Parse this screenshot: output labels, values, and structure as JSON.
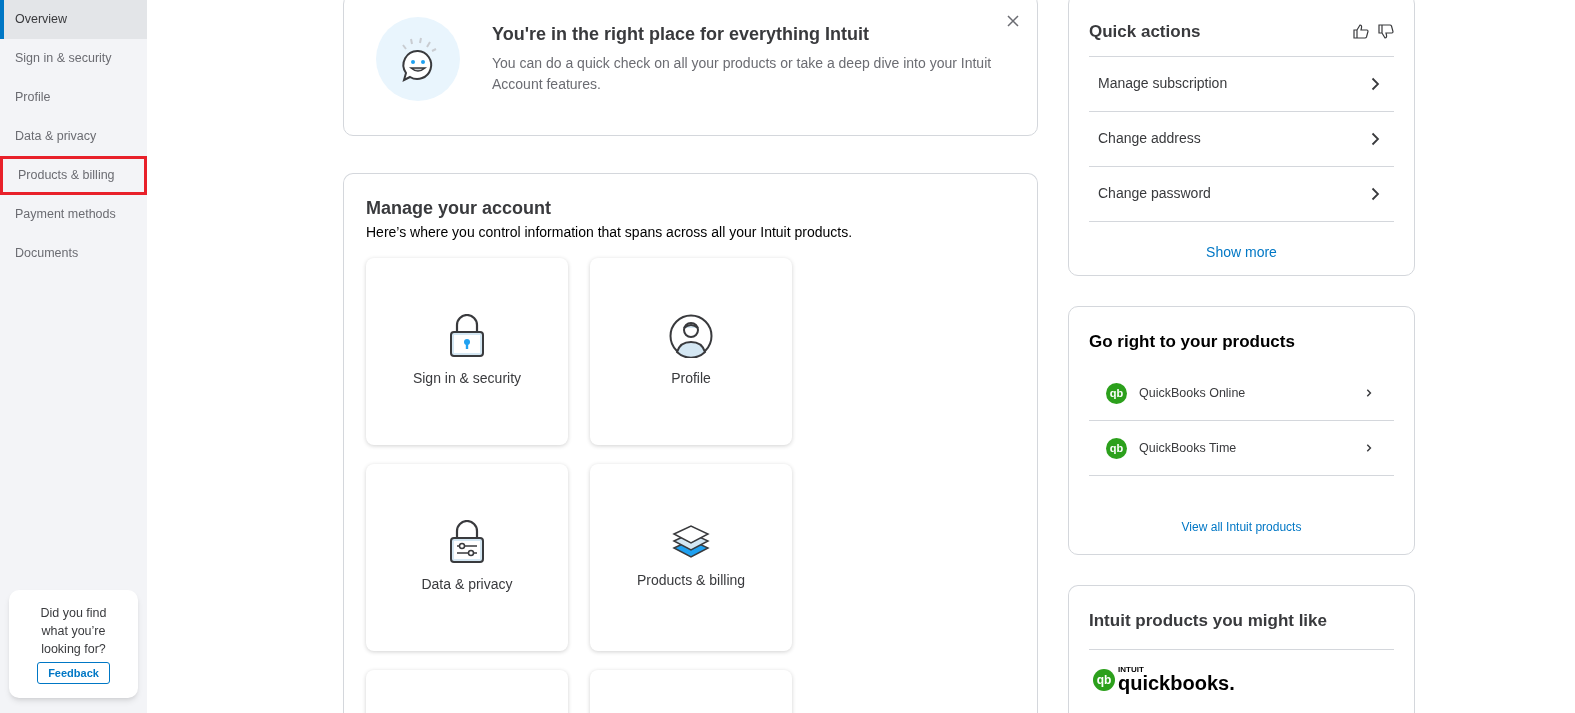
{
  "sidebar": {
    "items": [
      {
        "label": "Overview",
        "selected": true,
        "highlighted": false
      },
      {
        "label": "Sign in & security",
        "selected": false,
        "highlighted": false
      },
      {
        "label": "Profile",
        "selected": false,
        "highlighted": false
      },
      {
        "label": "Data & privacy",
        "selected": false,
        "highlighted": false
      },
      {
        "label": "Products & billing",
        "selected": false,
        "highlighted": true
      },
      {
        "label": "Payment methods",
        "selected": false,
        "highlighted": false
      },
      {
        "label": "Documents",
        "selected": false,
        "highlighted": false
      }
    ],
    "feedback": {
      "question": "Did you find what you’re looking for?",
      "button": "Feedback"
    }
  },
  "banner": {
    "title": "You're in the right place for everything Intuit",
    "text": "You can do a quick check on all your products or take a deep dive into your Intuit Account features."
  },
  "manage": {
    "title": "Manage your account",
    "subtitle": "Here’s where you control information that spans across all your Intuit products.",
    "tiles": [
      {
        "kind": "lock",
        "label": "Sign in & security"
      },
      {
        "kind": "person",
        "label": "Profile"
      },
      {
        "kind": "sliders",
        "label": "Data & privacy"
      },
      {
        "kind": "layers",
        "label": "Products & billing"
      },
      {
        "kind": "blank"
      },
      {
        "kind": "blank"
      }
    ]
  },
  "quick_actions": {
    "title": "Quick actions",
    "items": [
      "Manage subscription",
      "Change address",
      "Change password"
    ],
    "more": "Show more"
  },
  "products": {
    "title": "Go right to your products",
    "items": [
      {
        "logo": "qb",
        "name": "QuickBooks Online"
      },
      {
        "logo": "qb",
        "name": "QuickBooks Time"
      }
    ],
    "link": "View all Intuit products"
  },
  "suggested": {
    "title": "Intuit products you might like",
    "logo": {
      "mark": "qb",
      "brand": "INTUIT",
      "name": "quickbooks."
    }
  }
}
